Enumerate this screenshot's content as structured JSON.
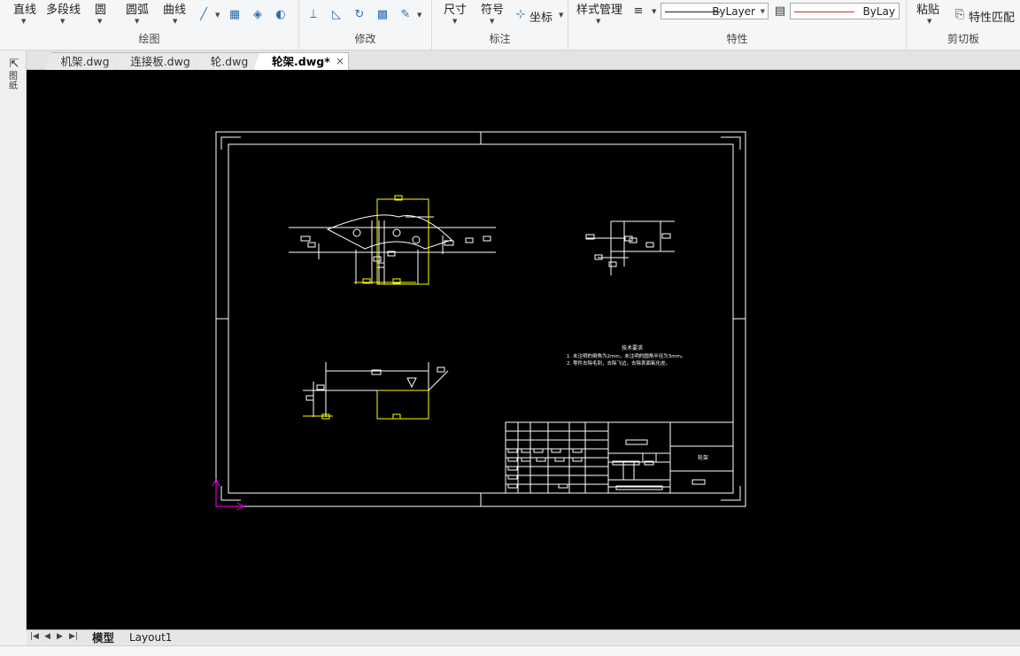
{
  "ribbon": {
    "draw": {
      "label": "绘图",
      "line": "直线",
      "polyline": "多段线",
      "circle": "圆",
      "arc": "圆弧",
      "curve": "曲线"
    },
    "modify": {
      "label": "修改"
    },
    "annotation": {
      "label": "标注",
      "dimension": "尺寸",
      "symbol": "符号",
      "coordinate": "坐标"
    },
    "properties": {
      "label": "特性",
      "style_manager": "样式管理",
      "linetype_value": "ByLayer",
      "lineweight_value": "ByLay"
    },
    "clipboard": {
      "label": "剪切板",
      "paste": "粘贴",
      "match_properties": "特性匹配"
    }
  },
  "file_tabs": [
    {
      "label": "机架.dwg",
      "active": false
    },
    {
      "label": "连接板.dwg",
      "active": false
    },
    {
      "label": "轮.dwg",
      "active": false
    },
    {
      "label": "轮架.dwg*",
      "active": true
    }
  ],
  "tab_close_glyph": "×",
  "left_strip": {
    "label": "图纸"
  },
  "layout_tabs": [
    {
      "label": "模型",
      "active": true
    },
    {
      "label": "Layout1",
      "active": false
    }
  ],
  "drawing": {
    "tech_req_title": "技术要求",
    "tech_req_line1": "1. 未注明的倒角为2mm，未注明的圆角半径为3mm。",
    "tech_req_line2": "2. 零件去除毛刺，去除飞边，去除表面氧化皮。",
    "title_block_name": "轮架"
  },
  "colors": {
    "geometry": "#ffffff",
    "highlight": "#ffff00",
    "ucs": "#ff00ff",
    "canvas": "#000000"
  }
}
